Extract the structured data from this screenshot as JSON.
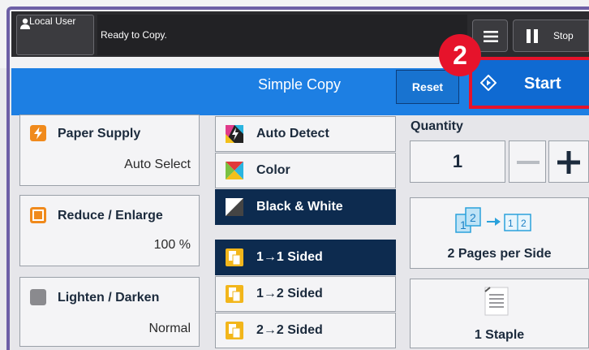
{
  "header": {
    "user_label": "Local User",
    "status_text": "Ready to Copy.",
    "stop_label": "Stop"
  },
  "title_bar": {
    "title": "Simple Copy",
    "reset_label": "Reset",
    "start_label": "Start",
    "badge_number": "2"
  },
  "left_tiles": [
    {
      "title": "Paper Supply",
      "value": "Auto Select"
    },
    {
      "title": "Reduce / Enlarge",
      "value": "100 %"
    },
    {
      "title": "Lighten / Darken",
      "value": "Normal"
    }
  ],
  "color_options": [
    {
      "label": "Auto Detect",
      "selected": false
    },
    {
      "label": "Color",
      "selected": false
    },
    {
      "label": "Black & White",
      "selected": true
    }
  ],
  "sided_options": [
    {
      "label": "1→1 Sided",
      "selected": true
    },
    {
      "label": "1→2 Sided",
      "selected": false
    },
    {
      "label": "2→2 Sided",
      "selected": false
    }
  ],
  "quantity": {
    "label": "Quantity",
    "value": "1"
  },
  "features": [
    {
      "label": "2 Pages per Side"
    },
    {
      "label": "1 Staple"
    }
  ],
  "colors": {
    "accent_blue": "#1d7fe3",
    "selected_navy": "#0d2b4f",
    "highlight_red": "#e6132b",
    "icon_orange": "#f08a1c"
  }
}
